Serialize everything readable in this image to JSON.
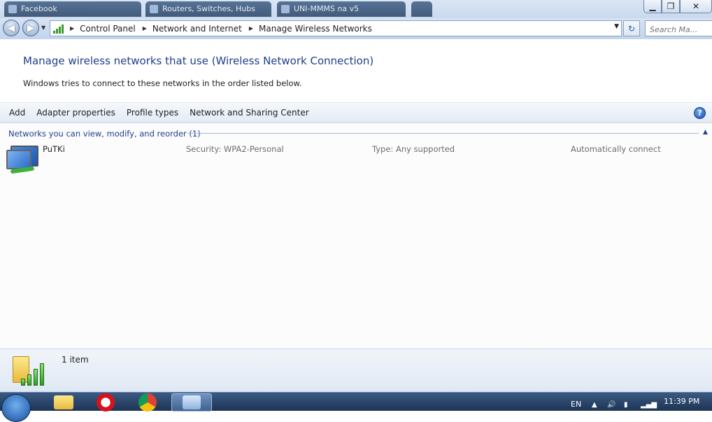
{
  "browser_tabs": [
    {
      "label": "Facebook"
    },
    {
      "label": "Routers, Switches, Hubs"
    },
    {
      "label": "UNI-MMMS na v5"
    }
  ],
  "address": {
    "crumbs": [
      "Control Panel",
      "Network and Internet",
      "Manage Wireless Networks"
    ],
    "search_placeholder": "Search Ma..."
  },
  "content": {
    "heading": "Manage wireless networks that use (Wireless Network Connection)",
    "subtitle": "Windows tries to connect to these networks in the order listed below."
  },
  "toolbar": {
    "add": "Add",
    "adapter": "Adapter properties",
    "profile": "Profile types",
    "sharing": "Network and Sharing Center"
  },
  "group": {
    "title": "Networks you can view, modify, and reorder (1)"
  },
  "networks": [
    {
      "name": "PuTKi",
      "security_label": "Security:",
      "security_value": "WPA2-Personal",
      "type_label": "Type:",
      "type_value": "Any supported",
      "mode": "Automatically connect"
    }
  ],
  "details": {
    "count": "1 item"
  },
  "taskbar": {
    "lang": "EN",
    "time": "11:39 PM"
  },
  "icons": {
    "back": "back-arrow-icon",
    "forward": "forward-arrow-icon",
    "help": "help-icon",
    "network": "wireless-network-icon"
  },
  "colors": {
    "heading": "#1e3f8e",
    "accent": "#2a5fab"
  }
}
